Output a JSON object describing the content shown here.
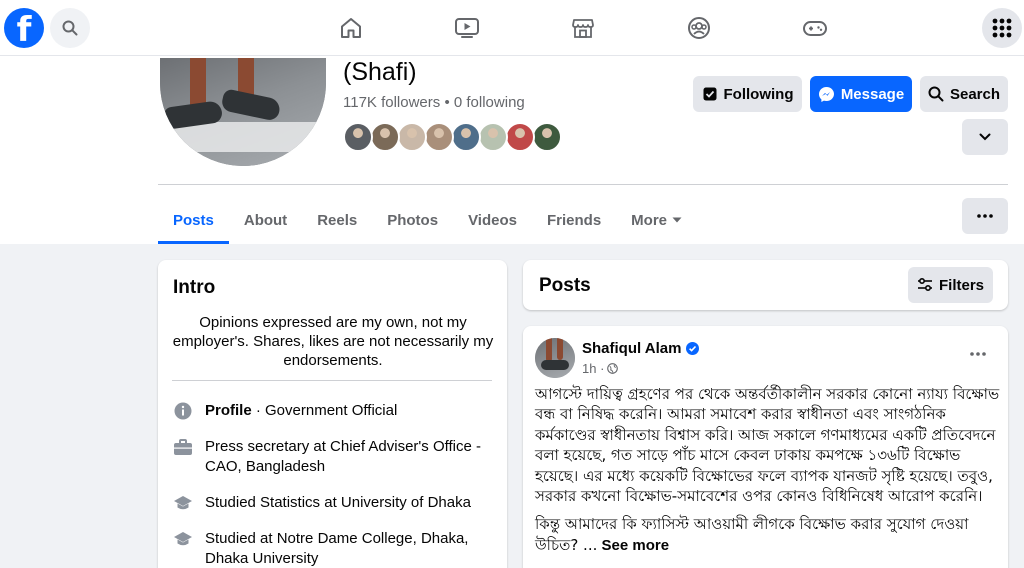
{
  "nav": {
    "logo_letter": "f",
    "icons": [
      "search-icon",
      "home-icon",
      "video-icon",
      "marketplace-icon",
      "groups-icon",
      "gaming-icon",
      "apps-grid-icon"
    ]
  },
  "profile": {
    "name": "(Shafi)",
    "followers": "117K followers",
    "separator": " • ",
    "following": "0 following",
    "friend_avatar_colors": [
      "#5a5e63",
      "#7b6a58",
      "#c9b8a8",
      "#a98f7a",
      "#4f6e8a",
      "#b7c2b0",
      "#c04848",
      "#3e5a3e"
    ]
  },
  "actions": {
    "following_label": "Following",
    "message_label": "Message",
    "search_label": "Search"
  },
  "tabs": [
    {
      "label": "Posts",
      "active": true
    },
    {
      "label": "About"
    },
    {
      "label": "Reels"
    },
    {
      "label": "Photos"
    },
    {
      "label": "Videos"
    },
    {
      "label": "Friends"
    },
    {
      "label": "More"
    }
  ],
  "intro": {
    "title": "Intro",
    "bio": "Opinions expressed are my own, not my employer's. Shares, likes are not necessarily my endorsements.",
    "profile_label": "Profile",
    "profile_value": " · Government Official",
    "work": "Press secretary at Chief Adviser's Office - CAO, Bangladesh",
    "edu1": "Studied Statistics at University of Dhaka",
    "edu2": "Studied at Notre Dame College, Dhaka, Dhaka University"
  },
  "posts_section": {
    "title": "Posts",
    "filters_label": "Filters"
  },
  "post": {
    "author": "Shafiqul Alam",
    "time": "1h ·",
    "body_p1": "আগস্টে দায়িত্ব গ্রহণের পর থেকে অন্তর্বর্তীকালীন সরকার কোনো ন্যায্য বিক্ষোভ বন্ধ বা নিষিদ্ধ করেনি। আমরা সমাবেশ করার স্বাধীনতা এবং সাংগঠনিক কর্মকাণ্ডের স্বাধীনতায় বিশ্বাস করি। আজ সকালে গণমাধ্যমের একটি প্রতিবেদনে বলা হয়েছে, গত সাড়ে পাঁচ মাসে কেবল ঢাকায় কমপক্ষে ১৩৬টি বিক্ষোভ হয়েছে। এর মধ্যে কয়েকটি বিক্ষোভের ফলে ব্যাপক যানজট সৃষ্টি হয়েছে। তবুও, সরকার কখনো বিক্ষোভ-সমাবেশের ওপর কোনও বিধিনিষেধ আরোপ করেনি।",
    "body_p2": "কিন্তু আমাদের কি ফ্যাসিস্ট আওয়ামী লীগকে বিক্ষোভ করার সুযোগ দেওয়া উচিত? ...",
    "see_more": " See more"
  },
  "colors": {
    "brand": "#0866ff",
    "bg": "#f0f2f5",
    "muted": "#65676b"
  }
}
